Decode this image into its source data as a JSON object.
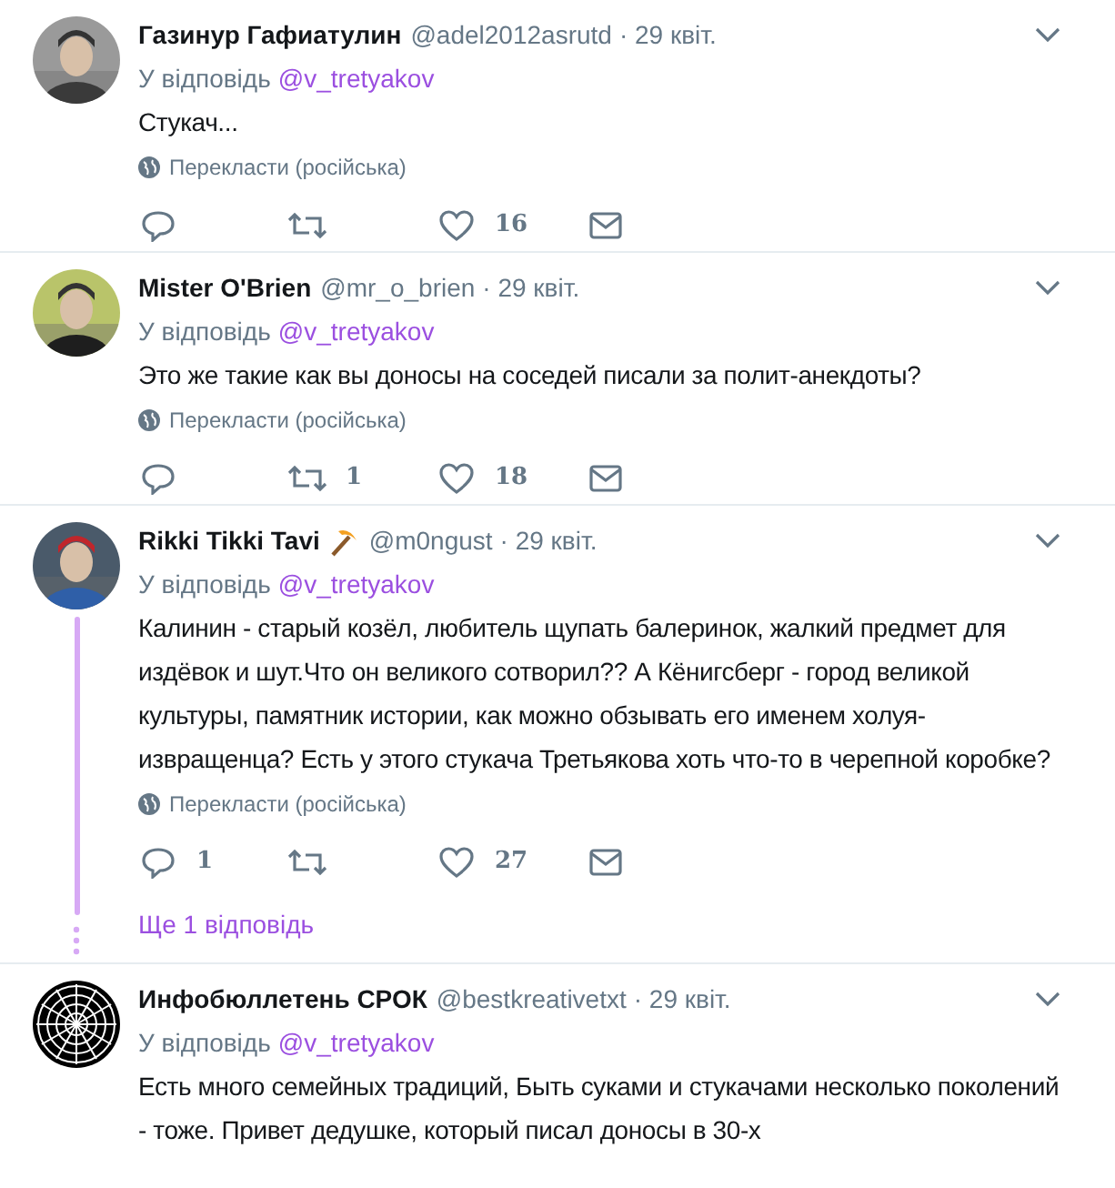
{
  "tweets": [
    {
      "name": "Газинур Гафиатулин",
      "name_badge": false,
      "handle": "@adel2012asrutd",
      "date": "· 29 квіт.",
      "reply_prefix": "У відповідь",
      "reply_to": "@v_tretyakov",
      "text": "Стукач...",
      "translate": "Перекласти (російська)",
      "likes": "16",
      "thread": false
    },
    {
      "name": "Mister O'Brien",
      "name_badge": false,
      "handle": "@mr_o_brien",
      "date": "· 29 квіт.",
      "reply_prefix": "У відповідь",
      "reply_to": "@v_tretyakov",
      "text": "Это же такие как вы доносы на соседей писали за полит-анекдоты?",
      "translate": "Перекласти (російська)",
      "retweets": "1",
      "likes": "18",
      "thread": false
    },
    {
      "name": "Rikki Tikki Tavi",
      "name_badge": true,
      "handle": "@m0ngust",
      "date": "· 29 квіт.",
      "reply_prefix": "У відповідь",
      "reply_to": "@v_tretyakov",
      "text": "Калинин - старый козёл, любитель щупать балеринок, жалкий предмет для издёвок и шут.Что он великого сотворил?? А Кёнигсберг - город великой культуры, памятник истории, как можно обзывать его именем холуя-извращенца? Есть у этого стукача Третьякова хоть что-то в черепной коробке?",
      "translate": "Перекласти (російська)",
      "replies": "1",
      "likes": "27",
      "thread": true,
      "more_replies": "Ще 1 відповідь"
    },
    {
      "avatar": {
        "kind": "logo"
      },
      "name": "Инфобюллетень СРОК",
      "name_badge": false,
      "handle": "@bestkreativetxt",
      "date": "· 29 квіт.",
      "reply_prefix": "У відповідь",
      "reply_to": "@v_tretyakov",
      "text": "Есть много семейных традиций, Быть суками и стукачами несколько поколений - тоже. Привет дедушке, который писал доносы в 30-х",
      "thread": false
    }
  ]
}
